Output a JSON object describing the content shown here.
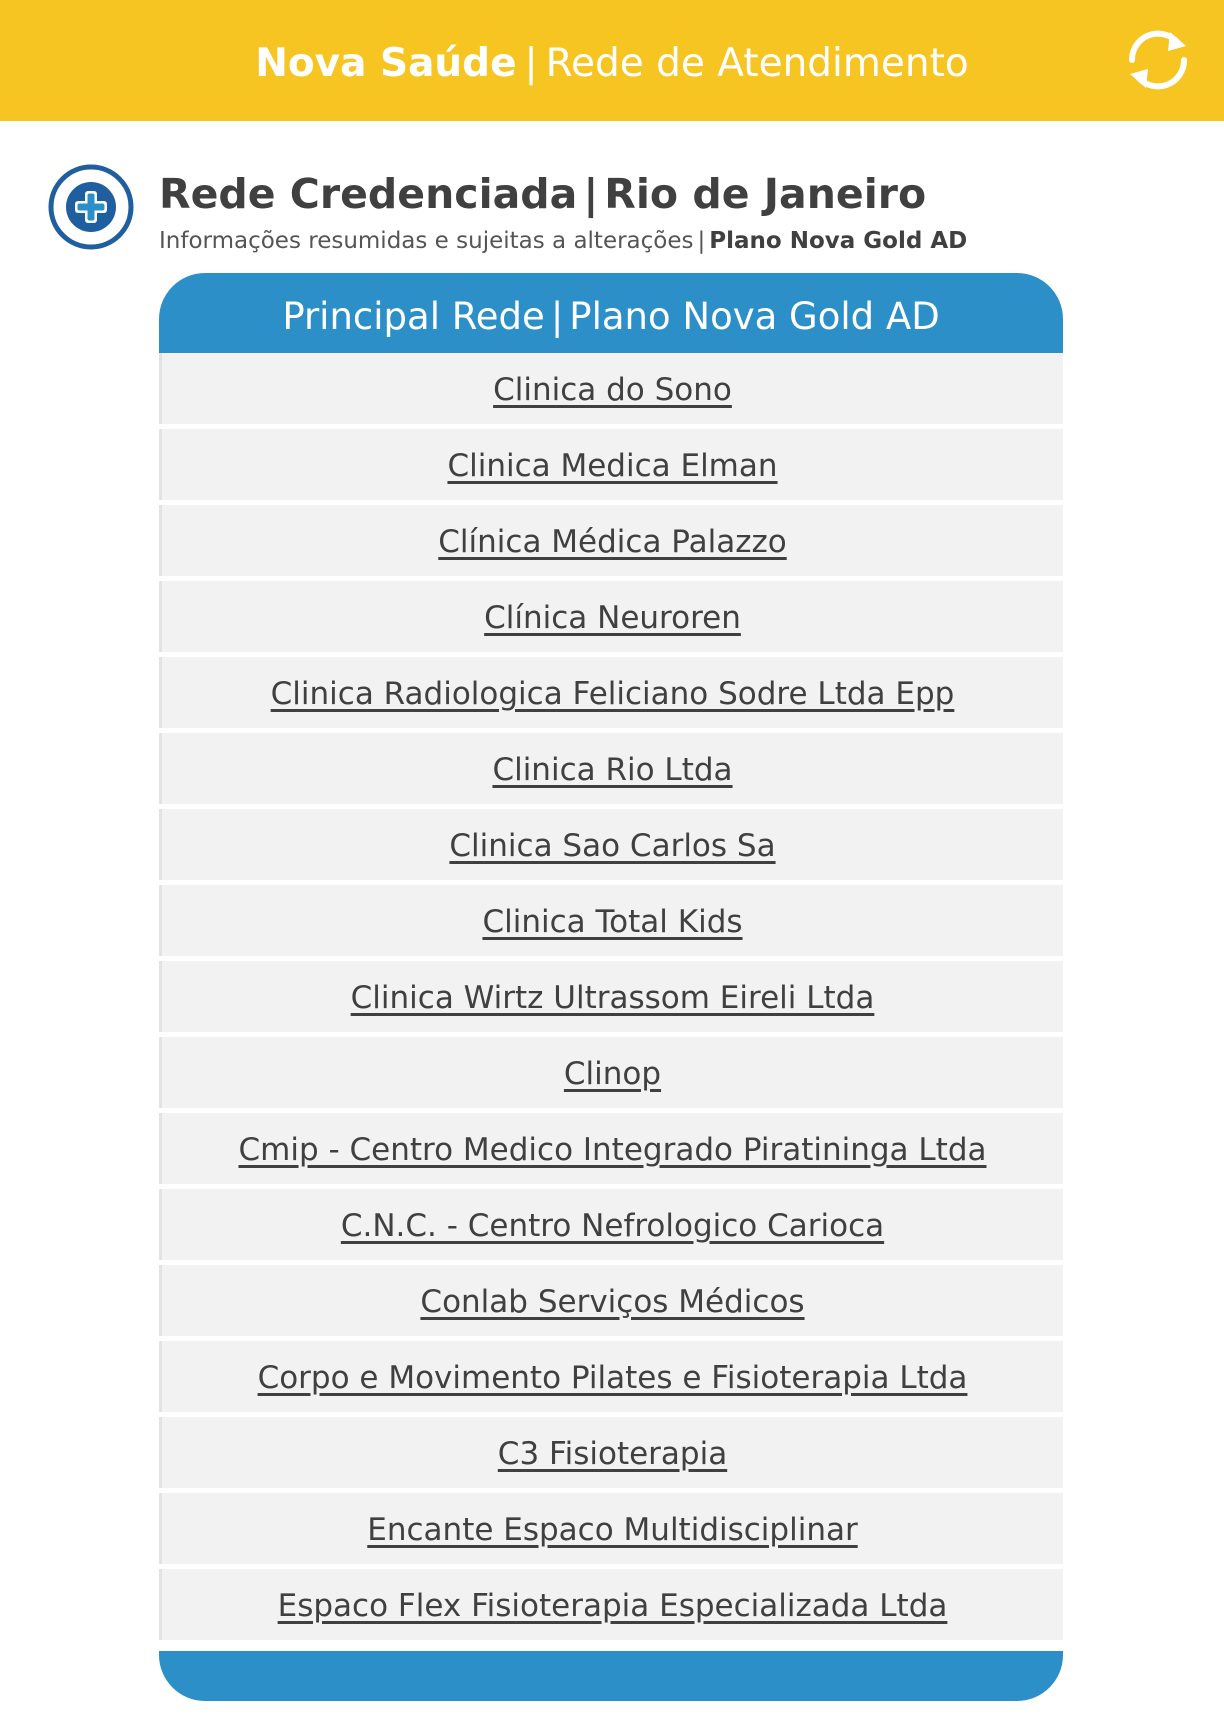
{
  "header": {
    "brand": "Nova Saúde",
    "separator": "|",
    "section": "Rede de Atendimento",
    "refresh_icon": "refresh-icon"
  },
  "page": {
    "icon": "medical-cross-icon",
    "title_main": "Rede Credenciada",
    "title_separator": "|",
    "title_city": "Rio de Janeiro",
    "subtitle": "Informações resumidas e sujeitas a alterações",
    "subtitle_separator": "|",
    "plan": "Plano Nova Gold AD"
  },
  "panel": {
    "header_left": "Principal Rede",
    "header_separator": "|",
    "header_right": "Plano Nova Gold AD",
    "items": [
      "Clinica do Sono",
      "Clinica Medica Elman",
      "Clínica Médica Palazzo",
      "Clínica Neuroren",
      "Clinica Radiologica Feliciano Sodre Ltda Epp",
      "Clinica Rio Ltda",
      "Clinica Sao Carlos Sa",
      "Clinica Total Kids",
      "Clinica Wirtz Ultrassom Eireli Ltda",
      "Clinop",
      "Cmip - Centro Medico Integrado Piratininga Ltda",
      "C.N.C. - Centro Nefrologico Carioca",
      "Conlab Serviços Médicos",
      "Corpo e Movimento Pilates e Fisioterapia Ltda",
      "C3 Fisioterapia",
      "Encante Espaco Multidisciplinar",
      "Espaco Flex Fisioterapia Especializada Ltda"
    ]
  },
  "colors": {
    "topbar": "#F6C522",
    "panel_accent": "#2D8FC7",
    "icon_blue": "#1F5FA0",
    "text": "#404040"
  }
}
